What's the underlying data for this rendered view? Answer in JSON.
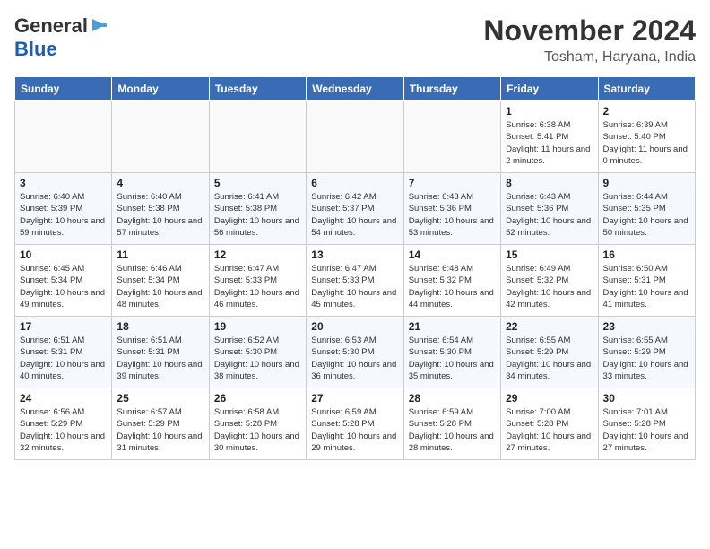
{
  "header": {
    "logo_general": "General",
    "logo_blue": "Blue",
    "month_title": "November 2024",
    "location": "Tosham, Haryana, India"
  },
  "calendar": {
    "days_of_week": [
      "Sunday",
      "Monday",
      "Tuesday",
      "Wednesday",
      "Thursday",
      "Friday",
      "Saturday"
    ],
    "weeks": [
      [
        {
          "day": "",
          "info": ""
        },
        {
          "day": "",
          "info": ""
        },
        {
          "day": "",
          "info": ""
        },
        {
          "day": "",
          "info": ""
        },
        {
          "day": "",
          "info": ""
        },
        {
          "day": "1",
          "info": "Sunrise: 6:38 AM\nSunset: 5:41 PM\nDaylight: 11 hours and 2 minutes."
        },
        {
          "day": "2",
          "info": "Sunrise: 6:39 AM\nSunset: 5:40 PM\nDaylight: 11 hours and 0 minutes."
        }
      ],
      [
        {
          "day": "3",
          "info": "Sunrise: 6:40 AM\nSunset: 5:39 PM\nDaylight: 10 hours and 59 minutes."
        },
        {
          "day": "4",
          "info": "Sunrise: 6:40 AM\nSunset: 5:38 PM\nDaylight: 10 hours and 57 minutes."
        },
        {
          "day": "5",
          "info": "Sunrise: 6:41 AM\nSunset: 5:38 PM\nDaylight: 10 hours and 56 minutes."
        },
        {
          "day": "6",
          "info": "Sunrise: 6:42 AM\nSunset: 5:37 PM\nDaylight: 10 hours and 54 minutes."
        },
        {
          "day": "7",
          "info": "Sunrise: 6:43 AM\nSunset: 5:36 PM\nDaylight: 10 hours and 53 minutes."
        },
        {
          "day": "8",
          "info": "Sunrise: 6:43 AM\nSunset: 5:36 PM\nDaylight: 10 hours and 52 minutes."
        },
        {
          "day": "9",
          "info": "Sunrise: 6:44 AM\nSunset: 5:35 PM\nDaylight: 10 hours and 50 minutes."
        }
      ],
      [
        {
          "day": "10",
          "info": "Sunrise: 6:45 AM\nSunset: 5:34 PM\nDaylight: 10 hours and 49 minutes."
        },
        {
          "day": "11",
          "info": "Sunrise: 6:46 AM\nSunset: 5:34 PM\nDaylight: 10 hours and 48 minutes."
        },
        {
          "day": "12",
          "info": "Sunrise: 6:47 AM\nSunset: 5:33 PM\nDaylight: 10 hours and 46 minutes."
        },
        {
          "day": "13",
          "info": "Sunrise: 6:47 AM\nSunset: 5:33 PM\nDaylight: 10 hours and 45 minutes."
        },
        {
          "day": "14",
          "info": "Sunrise: 6:48 AM\nSunset: 5:32 PM\nDaylight: 10 hours and 44 minutes."
        },
        {
          "day": "15",
          "info": "Sunrise: 6:49 AM\nSunset: 5:32 PM\nDaylight: 10 hours and 42 minutes."
        },
        {
          "day": "16",
          "info": "Sunrise: 6:50 AM\nSunset: 5:31 PM\nDaylight: 10 hours and 41 minutes."
        }
      ],
      [
        {
          "day": "17",
          "info": "Sunrise: 6:51 AM\nSunset: 5:31 PM\nDaylight: 10 hours and 40 minutes."
        },
        {
          "day": "18",
          "info": "Sunrise: 6:51 AM\nSunset: 5:31 PM\nDaylight: 10 hours and 39 minutes."
        },
        {
          "day": "19",
          "info": "Sunrise: 6:52 AM\nSunset: 5:30 PM\nDaylight: 10 hours and 38 minutes."
        },
        {
          "day": "20",
          "info": "Sunrise: 6:53 AM\nSunset: 5:30 PM\nDaylight: 10 hours and 36 minutes."
        },
        {
          "day": "21",
          "info": "Sunrise: 6:54 AM\nSunset: 5:30 PM\nDaylight: 10 hours and 35 minutes."
        },
        {
          "day": "22",
          "info": "Sunrise: 6:55 AM\nSunset: 5:29 PM\nDaylight: 10 hours and 34 minutes."
        },
        {
          "day": "23",
          "info": "Sunrise: 6:55 AM\nSunset: 5:29 PM\nDaylight: 10 hours and 33 minutes."
        }
      ],
      [
        {
          "day": "24",
          "info": "Sunrise: 6:56 AM\nSunset: 5:29 PM\nDaylight: 10 hours and 32 minutes."
        },
        {
          "day": "25",
          "info": "Sunrise: 6:57 AM\nSunset: 5:29 PM\nDaylight: 10 hours and 31 minutes."
        },
        {
          "day": "26",
          "info": "Sunrise: 6:58 AM\nSunset: 5:28 PM\nDaylight: 10 hours and 30 minutes."
        },
        {
          "day": "27",
          "info": "Sunrise: 6:59 AM\nSunset: 5:28 PM\nDaylight: 10 hours and 29 minutes."
        },
        {
          "day": "28",
          "info": "Sunrise: 6:59 AM\nSunset: 5:28 PM\nDaylight: 10 hours and 28 minutes."
        },
        {
          "day": "29",
          "info": "Sunrise: 7:00 AM\nSunset: 5:28 PM\nDaylight: 10 hours and 27 minutes."
        },
        {
          "day": "30",
          "info": "Sunrise: 7:01 AM\nSunset: 5:28 PM\nDaylight: 10 hours and 27 minutes."
        }
      ]
    ]
  }
}
